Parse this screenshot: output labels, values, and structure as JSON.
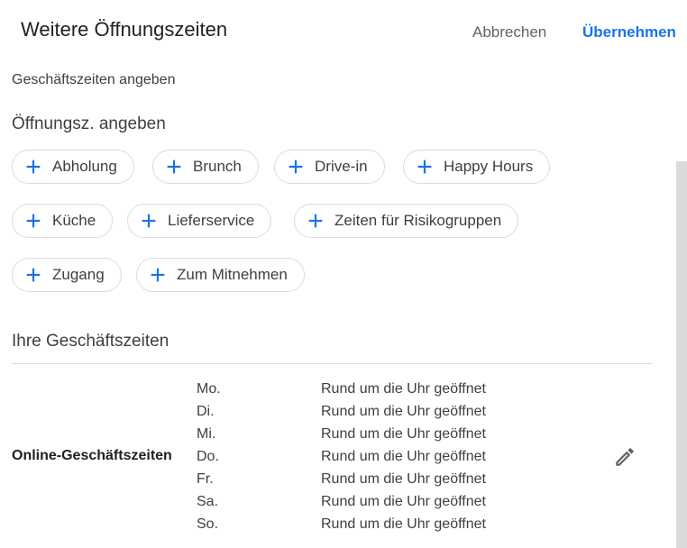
{
  "header": {
    "title": "Weitere Öffnungszeiten",
    "cancel_label": "Abbrechen",
    "apply_label": "Übernehmen"
  },
  "subtitle": "Geschäftszeiten angeben",
  "opening_section": {
    "title": "Öffnungsz. angeben",
    "chips": [
      {
        "label": "Abholung"
      },
      {
        "label": "Brunch"
      },
      {
        "label": "Drive-in"
      },
      {
        "label": "Happy Hours"
      },
      {
        "label": "Küche"
      },
      {
        "label": "Lieferservice"
      },
      {
        "label": "Zeiten für Risikogruppen"
      },
      {
        "label": "Zugang"
      },
      {
        "label": "Zum Mitnehmen"
      }
    ]
  },
  "business_hours": {
    "title": "Ihre Geschäftszeiten",
    "row_label": "Online-Geschäftszeiten",
    "days": [
      {
        "day": "Mo.",
        "hours": "Rund um die Uhr geöffnet"
      },
      {
        "day": "Di.",
        "hours": "Rund um die Uhr geöffnet"
      },
      {
        "day": "Mi.",
        "hours": "Rund um die Uhr geöffnet"
      },
      {
        "day": "Do.",
        "hours": "Rund um die Uhr geöffnet"
      },
      {
        "day": "Fr.",
        "hours": "Rund um die Uhr geöffnet"
      },
      {
        "day": "Sa.",
        "hours": "Rund um die Uhr geöffnet"
      },
      {
        "day": "So.",
        "hours": "Rund um die Uhr geöffnet"
      }
    ]
  },
  "icons": {
    "add": "plus-icon",
    "edit": "pencil-icon"
  },
  "colors": {
    "accent": "#1a73e8",
    "text": "#3c4043",
    "border": "#dadce0"
  }
}
